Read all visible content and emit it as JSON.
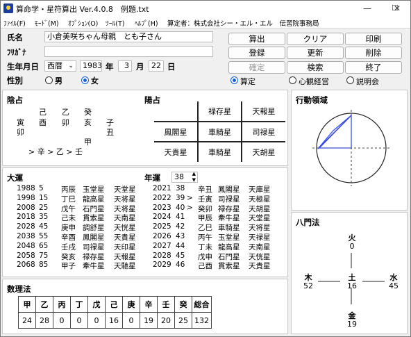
{
  "window": {
    "title": "算命学・星符算出 Ver.4.0.8　例題.txt",
    "minimize": "—",
    "maximize": "☐",
    "close": "✕"
  },
  "menu": [
    "ﾌｧｲﾙ(F)",
    "ﾓｰﾄﾞ(M)",
    "ｵﾌﾟｼｮﾝ(O)",
    "ﾂｰﾙ(T)",
    "ﾍﾙﾌﾟ(H)"
  ],
  "menu_note": "算定者：株式会社シー・エル・エル　伝習院事務局",
  "form": {
    "name_label": "氏名",
    "name_value": "小倉美咲ちゃん母親　とも子さん",
    "kana_label": "ﾌﾘｶﾞﾅ",
    "kana_value": "",
    "birth_label": "生年月日",
    "era": "西暦",
    "year": "1983",
    "year_unit": "年",
    "month": "3",
    "month_unit": "月",
    "day": "22",
    "day_unit": "日",
    "sex_label": "性別",
    "male": "男",
    "female": "女",
    "selected_sex": "女"
  },
  "buttons": [
    "算出",
    "クリア",
    "印刷",
    "登録",
    "更新",
    "削除",
    "確定",
    "検索",
    "終了"
  ],
  "mode": {
    "options": [
      "算定",
      "心観経営",
      "説明会"
    ],
    "selected": "算定"
  },
  "inyo": {
    "title": "陰占",
    "row1": [
      "己",
      "乙",
      "癸"
    ],
    "row2": [
      "寅",
      "酉",
      "卯",
      "亥",
      "子"
    ],
    "row3": [
      "卯",
      "丑"
    ],
    "row4": [
      "甲"
    ],
    "row5": "> 辛 > 乙 > 壬"
  },
  "yosen": {
    "title": "陽占",
    "grid": [
      [
        "",
        "禄存星",
        "天報星"
      ],
      [
        "鳳閣星",
        "車騎星",
        "司禄星"
      ],
      [
        "天貴星",
        "車騎星",
        "天胡星"
      ]
    ]
  },
  "kodo": {
    "title": "行動領域"
  },
  "taiun": {
    "title": "大運",
    "rows": [
      [
        "1988",
        "5",
        "丙辰",
        "玉堂星",
        "天堂星"
      ],
      [
        "1998",
        "15",
        "丁巳",
        "龍高星",
        "天将星"
      ],
      [
        "2008",
        "25",
        "戊午",
        "石門星",
        "天将星"
      ],
      [
        "2018",
        "35",
        "己未",
        "貫索星",
        "天南星"
      ],
      [
        "2028",
        "45",
        "庚申",
        "調舒星",
        "天恍星"
      ],
      [
        "2038",
        "55",
        "辛酉",
        "鳳閣星",
        "天貴星"
      ],
      [
        "2048",
        "65",
        "壬戌",
        "司禄星",
        "天印星"
      ],
      [
        "2058",
        "75",
        "癸亥",
        "禄存星",
        "天報星"
      ],
      [
        "2068",
        "85",
        "甲子",
        "牽牛星",
        "天馳星"
      ]
    ]
  },
  "nenun": {
    "title": "年運",
    "year_select": "38",
    "rows": [
      [
        "2021",
        "38",
        "",
        "辛丑",
        "鳳閣星",
        "天庫星"
      ],
      [
        "2022",
        "39",
        ">",
        "壬寅",
        "司禄星",
        "天極星"
      ],
      [
        "2023",
        "40",
        ">",
        "癸卯",
        "禄存星",
        "天胡星"
      ],
      [
        "2024",
        "41",
        "",
        "甲辰",
        "牽牛星",
        "天堂星"
      ],
      [
        "2025",
        "42",
        "",
        "乙巳",
        "車騎星",
        "天将星"
      ],
      [
        "2026",
        "43",
        "",
        "丙午",
        "玉堂星",
        "天禄星"
      ],
      [
        "2027",
        "44",
        "",
        "丁未",
        "龍高星",
        "天南星"
      ],
      [
        "2028",
        "45",
        "",
        "戊申",
        "石門星",
        "天恍星"
      ],
      [
        "2029",
        "46",
        "",
        "己酉",
        "貫索星",
        "天貴星"
      ]
    ]
  },
  "hachimon": {
    "title": "八門法",
    "fire": {
      "name": "火",
      "value": "0"
    },
    "wood": {
      "name": "木",
      "value": "52"
    },
    "earth": {
      "name": "土",
      "value": "16"
    },
    "water": {
      "name": "水",
      "value": "45"
    },
    "metal": {
      "name": "金",
      "value": "19"
    }
  },
  "suri": {
    "title": "数理法",
    "headers": [
      "甲",
      "乙",
      "丙",
      "丁",
      "戊",
      "己",
      "庚",
      "辛",
      "壬",
      "癸",
      "総合"
    ],
    "values": [
      "24",
      "28",
      "0",
      "0",
      "0",
      "16",
      "0",
      "19",
      "20",
      "25",
      "132"
    ]
  }
}
